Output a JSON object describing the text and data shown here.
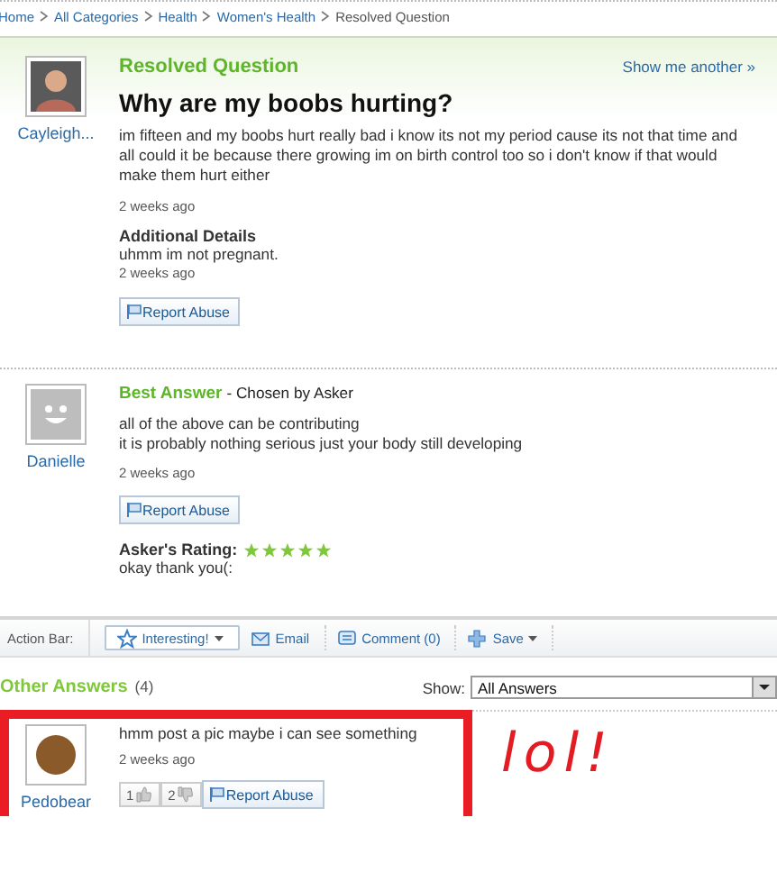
{
  "breadcrumb": [
    {
      "label": "Home",
      "kind": "link"
    },
    {
      "label": "All Categories",
      "kind": "link"
    },
    {
      "label": "Health",
      "kind": "link"
    },
    {
      "label": "Women's Health",
      "kind": "link"
    },
    {
      "label": "Resolved Question",
      "kind": "current"
    }
  ],
  "question": {
    "status": "Resolved Question",
    "show_another": "Show me another »",
    "author": "Cayleigh...",
    "title": "Why are my boobs hurting?",
    "body": "im fifteen and my boobs hurt really bad i know its not my period cause its not that time and all could it be because there growing im on birth control too so i don't know if that would make them hurt either",
    "time": "2 weeks ago",
    "details_label": "Additional Details",
    "details": "uhmm im not pregnant.",
    "details_time": "2 weeks ago",
    "report": "Report Abuse"
  },
  "best_answer": {
    "label": "Best Answer",
    "chosen_by": "- Chosen by Asker",
    "author": "Danielle",
    "lines": [
      "all of the above can be contributing",
      "it is probably nothing serious just your body still developing"
    ],
    "time": "2 weeks ago",
    "report": "Report Abuse",
    "rating_label": "Asker's Rating:",
    "stars": 5,
    "rating_comment": "okay thank you(:"
  },
  "action_bar": {
    "label": "Action Bar:",
    "buttons": [
      {
        "label": "Interesting!",
        "kind": "star",
        "dropdown": true
      },
      {
        "label": "Email",
        "kind": "mail",
        "dropdown": false
      },
      {
        "label": "Comment (0)",
        "kind": "comment",
        "dropdown": false
      },
      {
        "label": "Save",
        "kind": "plus",
        "dropdown": true
      }
    ]
  },
  "other_answers": {
    "title": "Other Answers",
    "count": "(4)",
    "show_label": "Show:",
    "show_value": "All Answers",
    "annotation": "lol!",
    "answers": [
      {
        "author": "Pedobear",
        "body": "hmm post a pic maybe i can see something",
        "time": "2 weeks ago",
        "thumbs_up": "1",
        "thumbs_down": "2",
        "report": "Report Abuse",
        "highlighted": true
      }
    ]
  }
}
